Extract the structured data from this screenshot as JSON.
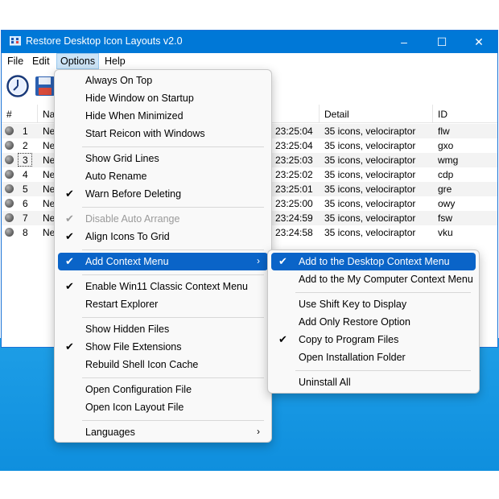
{
  "window": {
    "title": "Restore Desktop Icon Layouts v2.0",
    "icon": "app-icon",
    "controls": {
      "minimize": "–",
      "maximize": "☐",
      "close": "✕"
    }
  },
  "menubar": [
    "File",
    "Edit",
    "Options",
    "Help"
  ],
  "toolbar": [
    {
      "icon": "restore-clock-icon"
    },
    {
      "icon": "save-floppy-icon"
    }
  ],
  "list": {
    "columns": [
      "#",
      "Na",
      "Detail",
      "ID"
    ],
    "rows": [
      {
        "num": "1",
        "name": "Ne",
        "time": "23:25:04",
        "detail": "35 icons, velociraptor",
        "id": "flw"
      },
      {
        "num": "2",
        "name": "Ne",
        "time": "23:25:04",
        "detail": "35 icons, velociraptor",
        "id": "gxo"
      },
      {
        "num": "3",
        "name": "Ne",
        "time": "23:25:03",
        "detail": "35 icons, velociraptor",
        "id": "wmg"
      },
      {
        "num": "4",
        "name": "Ne",
        "time": "23:25:02",
        "detail": "35 icons, velociraptor",
        "id": "cdp"
      },
      {
        "num": "5",
        "name": "Ne",
        "time": "23:25:01",
        "detail": "35 icons, velociraptor",
        "id": "gre"
      },
      {
        "num": "6",
        "name": "Ne",
        "time": "23:25:00",
        "detail": "35 icons, velociraptor",
        "id": "owy"
      },
      {
        "num": "7",
        "name": "Ne",
        "time": "23:24:59",
        "detail": "35 icons, velociraptor",
        "id": "fsw"
      },
      {
        "num": "8",
        "name": "Ne",
        "time": "23:24:58",
        "detail": "35 icons, velociraptor",
        "id": "vku"
      }
    ]
  },
  "options_menu": {
    "items": [
      {
        "label": "Always On Top",
        "checked": false
      },
      {
        "label": "Hide Window on Startup",
        "checked": false
      },
      {
        "label": "Hide When Minimized",
        "checked": false
      },
      {
        "label": "Start Reicon with Windows",
        "checked": false
      },
      {
        "label": "Show Grid Lines",
        "checked": false
      },
      {
        "label": "Auto Rename",
        "checked": false
      },
      {
        "label": "Warn Before Deleting",
        "checked": true
      },
      {
        "label": "Disable Auto Arrange",
        "checked": true,
        "disabled": true
      },
      {
        "label": "Align Icons To Grid",
        "checked": true
      },
      {
        "label": "Add Context Menu",
        "checked": true,
        "highlighted": true,
        "submenu": true
      },
      {
        "label": "Enable Win11 Classic Context Menu",
        "checked": true
      },
      {
        "label": "Restart Explorer",
        "checked": false
      },
      {
        "label": "Show Hidden Files",
        "checked": false
      },
      {
        "label": "Show File Extensions",
        "checked": true
      },
      {
        "label": "Rebuild Shell Icon Cache",
        "checked": false
      },
      {
        "label": "Open Configuration File",
        "checked": false
      },
      {
        "label": "Open Icon Layout File",
        "checked": false
      },
      {
        "label": "Languages",
        "checked": false,
        "submenu": true
      }
    ],
    "check_glyph": "✔",
    "arrow_glyph": "›"
  },
  "context_submenu": {
    "items": [
      {
        "label": "Add to the Desktop Context Menu",
        "checked": true,
        "highlighted": true
      },
      {
        "label": "Add to the My Computer Context Menu",
        "checked": false
      },
      {
        "label": "Use Shift Key to Display",
        "checked": false
      },
      {
        "label": "Add Only Restore Option",
        "checked": false
      },
      {
        "label": "Copy to Program Files",
        "checked": true
      },
      {
        "label": "Open Installation Folder",
        "checked": false
      },
      {
        "label": "Uninstall All",
        "checked": false
      }
    ]
  },
  "colors": {
    "titlebar": "#0078d7",
    "menu_highlight": "#0a64c8",
    "desktop": "#1e9ee6"
  }
}
